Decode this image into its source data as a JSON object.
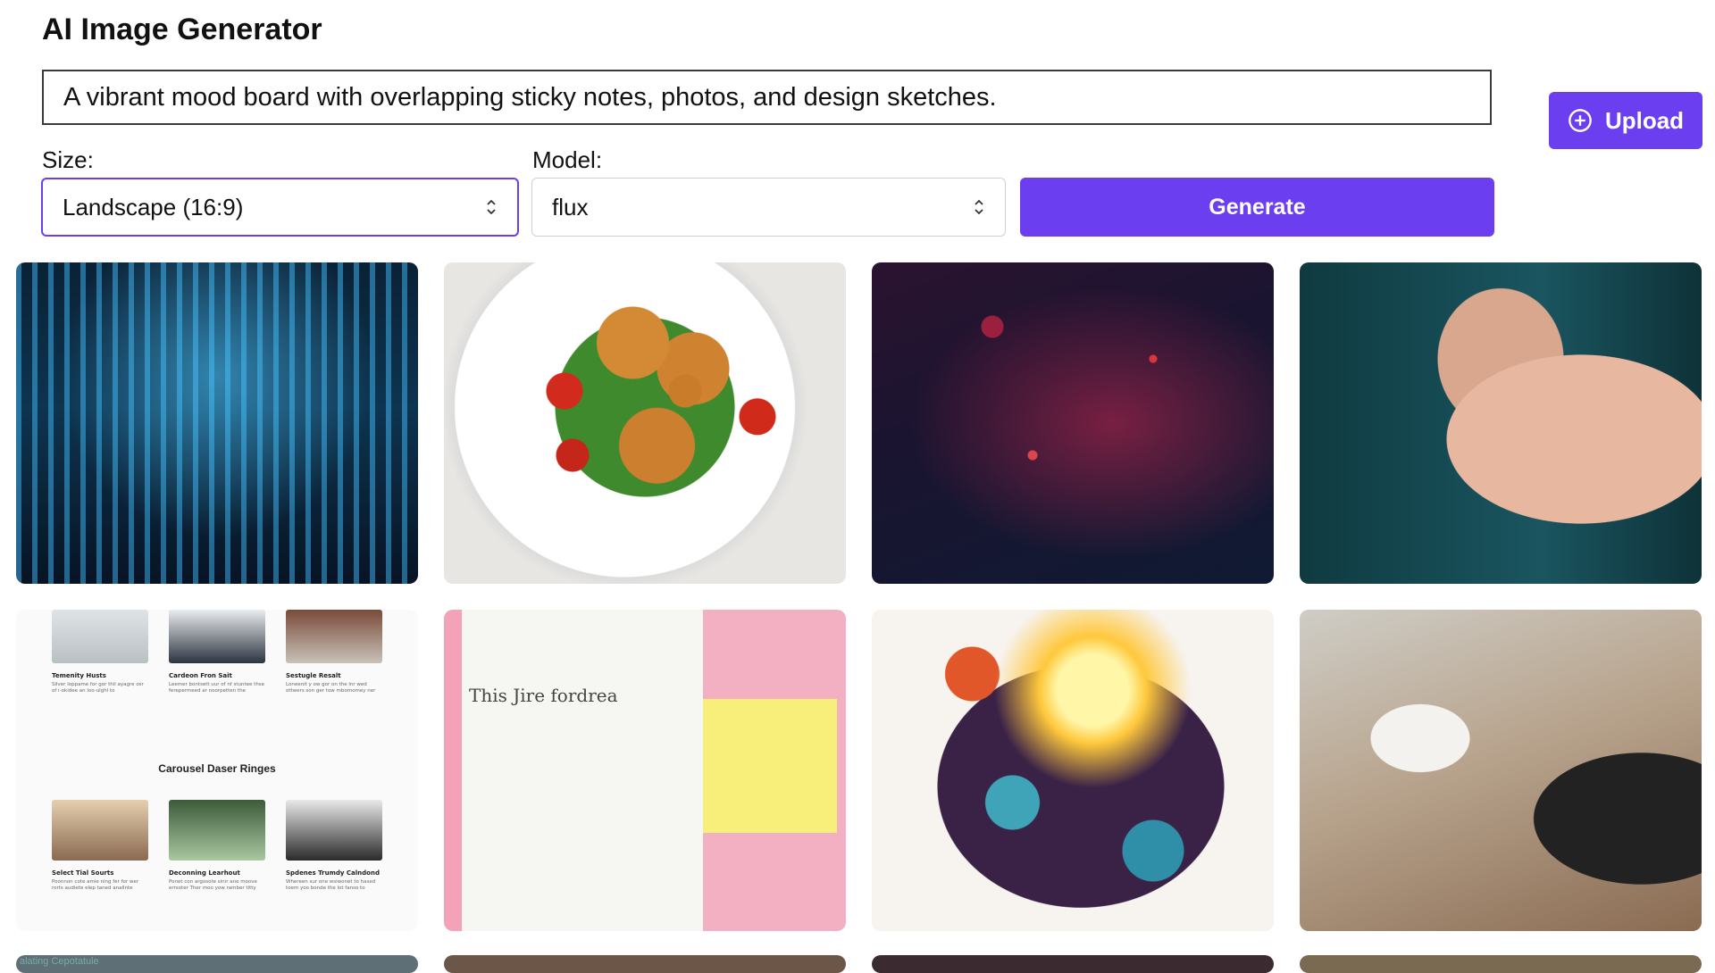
{
  "app": {
    "title": "AI Image Generator"
  },
  "prompt": {
    "value": "A vibrant mood board with overlapping sticky notes, photos, and design sketches."
  },
  "upload": {
    "label": "Upload",
    "icon": "plus-circle-icon"
  },
  "size": {
    "label": "Size:",
    "value": "Landscape (16:9)"
  },
  "model": {
    "label": "Model:",
    "value": "flux"
  },
  "generate": {
    "label": "Generate"
  },
  "colors": {
    "accent": "#6b3ff0"
  },
  "gallery": {
    "ui_tile": {
      "cards_top": [
        {
          "title": "Temenity Husts",
          "text": "Silver loppame for gor thil ayagre osr of i-okidee an loo-ulghl to"
        },
        {
          "title": "Cardeon Fron Sait",
          "text": "Leemer bontsett uur of nf stuntee thse ferepermeed ar noorpetten the"
        },
        {
          "title": "Sestugle Resalt",
          "text": "Loneenit y ow gor on the lnr wed ottwers son ger tow mbomomey ner"
        }
      ],
      "caption": "Carousel Daser Ringes",
      "cards_bottom": [
        {
          "title": "Select Tial Sourts",
          "text": "Poonnon cote amie ning fer for wer rorts audiete elep taned anallnte"
        },
        {
          "title": "Deconning Learhout",
          "text": "Ponet con argosote sinir ane moove errsoter Ther moo yow ramber titty"
        },
        {
          "title": "Spdenes Trumdy Calndond",
          "text": "Whereen sur one wsiwonet to hased toem yoo bonde the lot fanso to"
        }
      ]
    },
    "mood_tile": {
      "text": "This Jire fordrea"
    },
    "partial_tile": {
      "text": "alating Cepotatule"
    }
  }
}
